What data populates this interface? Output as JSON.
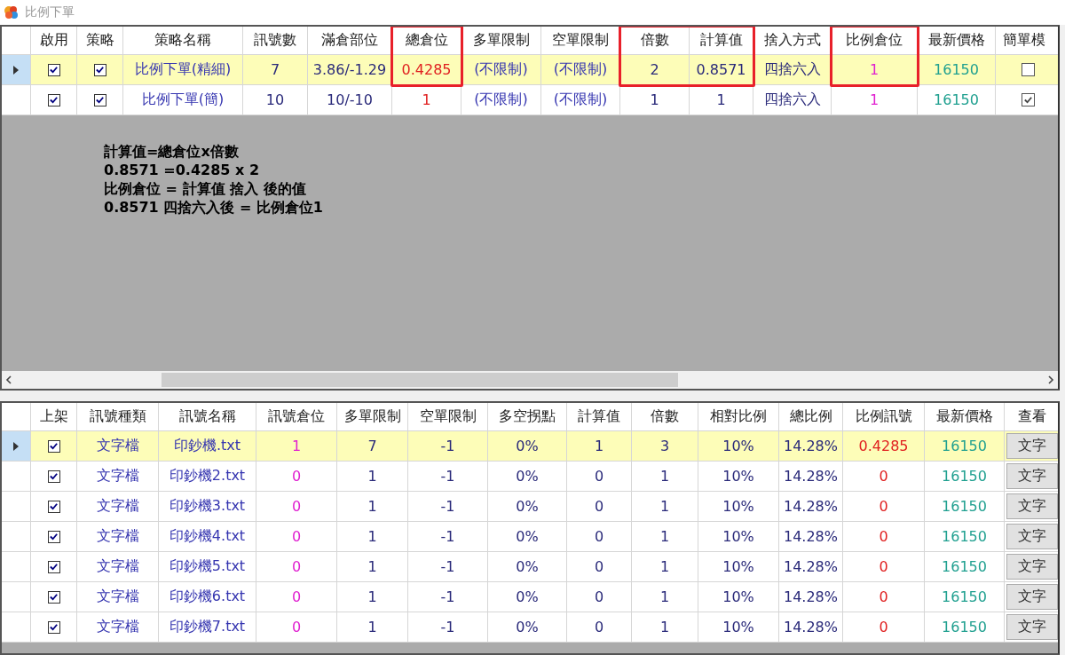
{
  "window": {
    "title": "比例下單"
  },
  "strategy_table": {
    "columns": [
      {
        "label": "啟用",
        "kind": "check",
        "marked": false
      },
      {
        "label": "策略",
        "kind": "check",
        "marked": false
      },
      {
        "label": "策略名稱",
        "kind": "text",
        "color": "#3535b0",
        "marked": false
      },
      {
        "label": "訊號數",
        "kind": "text",
        "color": "#2a2a7a",
        "marked": false
      },
      {
        "label": "滿倉部位",
        "kind": "text",
        "color": "#2a2a7a",
        "marked": false
      },
      {
        "label": "總倉位",
        "kind": "text",
        "color": "#e02020",
        "marked": true
      },
      {
        "label": "多單限制",
        "kind": "text",
        "color": "#3535b0",
        "marked": false
      },
      {
        "label": "空單限制",
        "kind": "text",
        "color": "#3535b0",
        "marked": false
      },
      {
        "label": "倍數",
        "kind": "text",
        "color": "#2a2a7a",
        "marked": true
      },
      {
        "label": "計算值",
        "kind": "text",
        "color": "#2a2a7a",
        "marked": true
      },
      {
        "label": "捨入方式",
        "kind": "text",
        "color": "#2a2a7a",
        "marked": false
      },
      {
        "label": "比例倉位",
        "kind": "text",
        "color": "#e020d0",
        "marked": true
      },
      {
        "label": "最新價格",
        "kind": "text",
        "color": "#20a090",
        "marked": false
      },
      {
        "label": "簡單模",
        "kind": "flatcheck",
        "marked": false
      }
    ],
    "rows": [
      {
        "selected": true,
        "cells": [
          true,
          true,
          "比例下單(精細)",
          "7",
          "3.86/-1.29",
          "0.4285",
          "(不限制)",
          "(不限制)",
          "2",
          "0.8571",
          "四捨六入",
          "1",
          "16150",
          false
        ]
      },
      {
        "selected": false,
        "cells": [
          true,
          true,
          "比例下單(簡)",
          "10",
          "10/-10",
          "1",
          "(不限制)",
          "(不限制)",
          "1",
          "1",
          "四捨六入",
          "1",
          "16150",
          true
        ]
      }
    ],
    "notes": [
      "計算值=總倉位x倍數",
      "0.8571 =0.4285 x 2",
      "比例倉位 = 計算值 捨入 後的值",
      "0.8571 四捨六入後 = 比例倉位1"
    ]
  },
  "signal_table": {
    "columns": [
      {
        "label": "上架",
        "kind": "check"
      },
      {
        "label": "訊號種類",
        "kind": "text",
        "color": "#3535b0"
      },
      {
        "label": "訊號名稱",
        "kind": "text",
        "color": "#3535b0"
      },
      {
        "label": "訊號倉位",
        "kind": "text",
        "color": "#e020d0"
      },
      {
        "label": "多單限制",
        "kind": "text",
        "color": "#2a2a7a"
      },
      {
        "label": "空單限制",
        "kind": "text",
        "color": "#2a2a7a"
      },
      {
        "label": "多空拐點",
        "kind": "text",
        "color": "#2a2a7a"
      },
      {
        "label": "計算值",
        "kind": "text",
        "color": "#2a2a7a"
      },
      {
        "label": "倍數",
        "kind": "text",
        "color": "#2a2a7a"
      },
      {
        "label": "相對比例",
        "kind": "text",
        "color": "#2a2a7a"
      },
      {
        "label": "總比例",
        "kind": "text",
        "color": "#2a2a7a"
      },
      {
        "label": "比例訊號",
        "kind": "text",
        "color": "#e02020"
      },
      {
        "label": "最新價格",
        "kind": "text",
        "color": "#20a090"
      },
      {
        "label": "查看",
        "kind": "button",
        "color": "#333333"
      }
    ],
    "rows": [
      {
        "selected": true,
        "cells": [
          true,
          "文字檔",
          "印鈔機.txt",
          "1",
          "7",
          "-1",
          "0%",
          "1",
          "3",
          "10%",
          "14.28%",
          "0.4285",
          "16150",
          "文字"
        ]
      },
      {
        "selected": false,
        "cells": [
          true,
          "文字檔",
          "印鈔機2.txt",
          "0",
          "1",
          "-1",
          "0%",
          "0",
          "1",
          "10%",
          "14.28%",
          "0",
          "16150",
          "文字"
        ]
      },
      {
        "selected": false,
        "cells": [
          true,
          "文字檔",
          "印鈔機3.txt",
          "0",
          "1",
          "-1",
          "0%",
          "0",
          "1",
          "10%",
          "14.28%",
          "0",
          "16150",
          "文字"
        ]
      },
      {
        "selected": false,
        "cells": [
          true,
          "文字檔",
          "印鈔機4.txt",
          "0",
          "1",
          "-1",
          "0%",
          "0",
          "1",
          "10%",
          "14.28%",
          "0",
          "16150",
          "文字"
        ]
      },
      {
        "selected": false,
        "cells": [
          true,
          "文字檔",
          "印鈔機5.txt",
          "0",
          "1",
          "-1",
          "0%",
          "0",
          "1",
          "10%",
          "14.28%",
          "0",
          "16150",
          "文字"
        ]
      },
      {
        "selected": false,
        "cells": [
          true,
          "文字檔",
          "印鈔機6.txt",
          "0",
          "1",
          "-1",
          "0%",
          "0",
          "1",
          "10%",
          "14.28%",
          "0",
          "16150",
          "文字"
        ]
      },
      {
        "selected": false,
        "cells": [
          true,
          "文字檔",
          "印鈔機7.txt",
          "0",
          "1",
          "-1",
          "0%",
          "0",
          "1",
          "10%",
          "14.28%",
          "0",
          "16150",
          "文字"
        ]
      }
    ]
  }
}
